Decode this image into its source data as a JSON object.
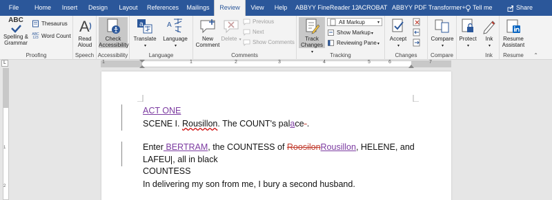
{
  "menu": {
    "tabs": [
      "File",
      "Home",
      "Insert",
      "Design",
      "Layout",
      "References",
      "Mailings",
      "Review",
      "View",
      "Help",
      "ABBYY FineReader 12",
      "ACROBAT",
      "ABBYY PDF Transformer+"
    ],
    "active_tab": "Review",
    "tell_me": "Tell me",
    "share": "Share"
  },
  "ribbon": {
    "proofing": {
      "label": "Proofing",
      "spelling": "Spelling &",
      "grammar": "Grammar",
      "thesaurus": "Thesaurus",
      "word_count": "Word Count",
      "abc_glyph": "ABC",
      "abc_small": "ABC",
      "abc_num": "123"
    },
    "speech": {
      "label": "Speech",
      "read": "Read",
      "aloud": "Aloud"
    },
    "accessibility": {
      "label": "Accessibility",
      "check": "Check",
      "access": "Accessibility"
    },
    "language": {
      "label": "Language",
      "translate": "Translate",
      "language": "Language"
    },
    "comments": {
      "label": "Comments",
      "new": "New",
      "comment": "Comment",
      "delete": "Delete",
      "previous": "Previous",
      "next": "Next",
      "show_comments": "Show Comments"
    },
    "tracking": {
      "label": "Tracking",
      "track": "Track",
      "changes": "Changes",
      "all_markup": "All Markup",
      "show_markup": "Show Markup",
      "reviewing_pane": "Reviewing Pane"
    },
    "changes": {
      "label": "Changes",
      "accept": "Accept"
    },
    "compare": {
      "label": "Compare",
      "compare": "Compare"
    },
    "protect": {
      "label": "Protect",
      "protect": "Protect"
    },
    "ink": {
      "label": "Ink",
      "ink": "Ink"
    },
    "resume": {
      "label": "Resume",
      "resume": "Resume",
      "assistant": "Assistant"
    }
  },
  "ruler": {
    "h_numbers": [
      "1",
      "1",
      "2",
      "3",
      "4",
      "5",
      "6",
      "7"
    ],
    "v_numbers": [
      "1",
      "2"
    ],
    "tab_selector": "L"
  },
  "document": {
    "act": "ACT ONE",
    "scene_a": "SCENE I. ",
    "scene_place": "Rousillon",
    "scene_b": ". The COUNT's pal",
    "scene_ins": "a",
    "scene_c": "ce",
    "scene_del": "-",
    "scene_end": ".",
    "enter_a": "Enter",
    "enter_ins": " BERTRAM",
    "enter_b": ", the COUNTESS of ",
    "enter_del": "Roosilon",
    "enter_ins2": "Rousillon",
    "enter_c": ", HELENE, and",
    "lafeu_a": "LAFEU",
    "lafeu_b": ", all in black",
    "countess": "COUNTESS",
    "line1": "In delivering my son from me, I bury a second husband."
  },
  "colors": {
    "ribbon_blue": "#2b579a",
    "insert_purple": "#7b3aa0",
    "delete_red": "#c0392b"
  }
}
